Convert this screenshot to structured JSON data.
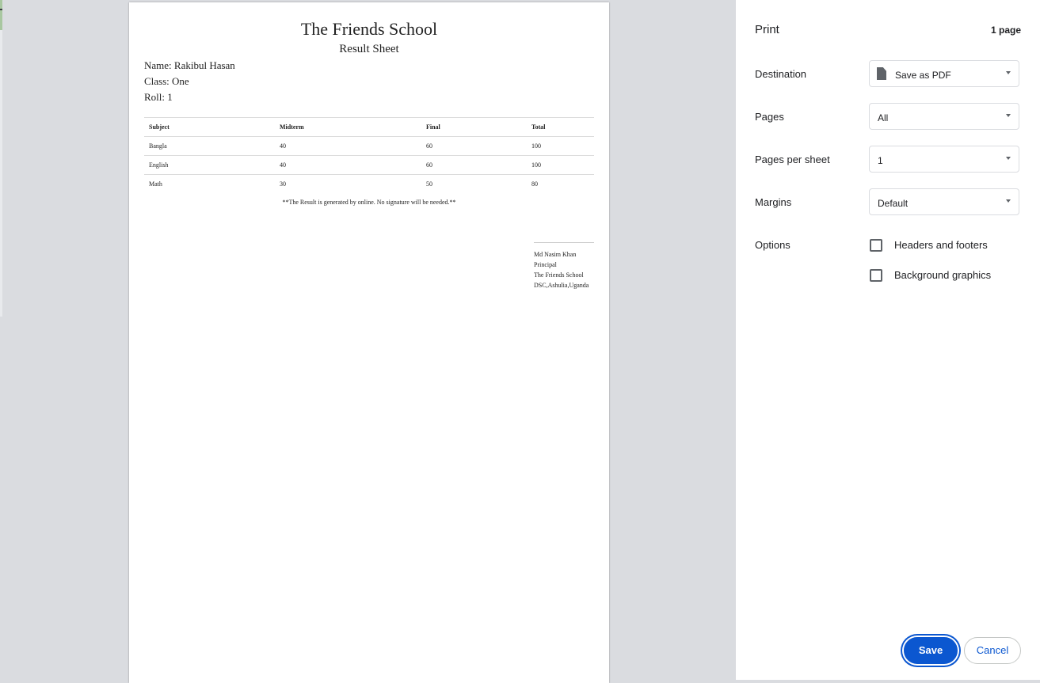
{
  "document": {
    "school_name": "The Friends School",
    "sheet_title": "Result Sheet",
    "name_line": "Name: Rakibul Hasan",
    "class_line": "Class: One",
    "roll_line": "Roll: 1",
    "table": {
      "headers": [
        "Subject",
        "Midterm",
        "Final",
        "Total"
      ],
      "rows": [
        [
          "Bangla",
          "40",
          "60",
          "100"
        ],
        [
          "English",
          "40",
          "60",
          "100"
        ],
        [
          "Math",
          "30",
          "50",
          "80"
        ]
      ]
    },
    "note": "**The Result is generated by online. No signature will be needed.**",
    "signature": {
      "name": "Md Nasim Khan",
      "title": "Principal",
      "school": "The Friends School",
      "address": "DSC,Ashulia,Uganda"
    }
  },
  "print_panel": {
    "title": "Print",
    "page_count": "1 page",
    "destination": {
      "label": "Destination",
      "value": "Save as PDF",
      "icon": "document-icon"
    },
    "pages": {
      "label": "Pages",
      "value": "All"
    },
    "pages_per_sheet": {
      "label": "Pages per sheet",
      "value": "1"
    },
    "margins": {
      "label": "Margins",
      "value": "Default"
    },
    "options": {
      "label": "Options",
      "headers_footers": {
        "label": "Headers and footers",
        "checked": false
      },
      "background_graphics": {
        "label": "Background graphics",
        "checked": false
      }
    },
    "save_label": "Save",
    "cancel_label": "Cancel"
  },
  "colors": {
    "accent": "#0b57d0",
    "preview_bg": "#dadce0"
  }
}
